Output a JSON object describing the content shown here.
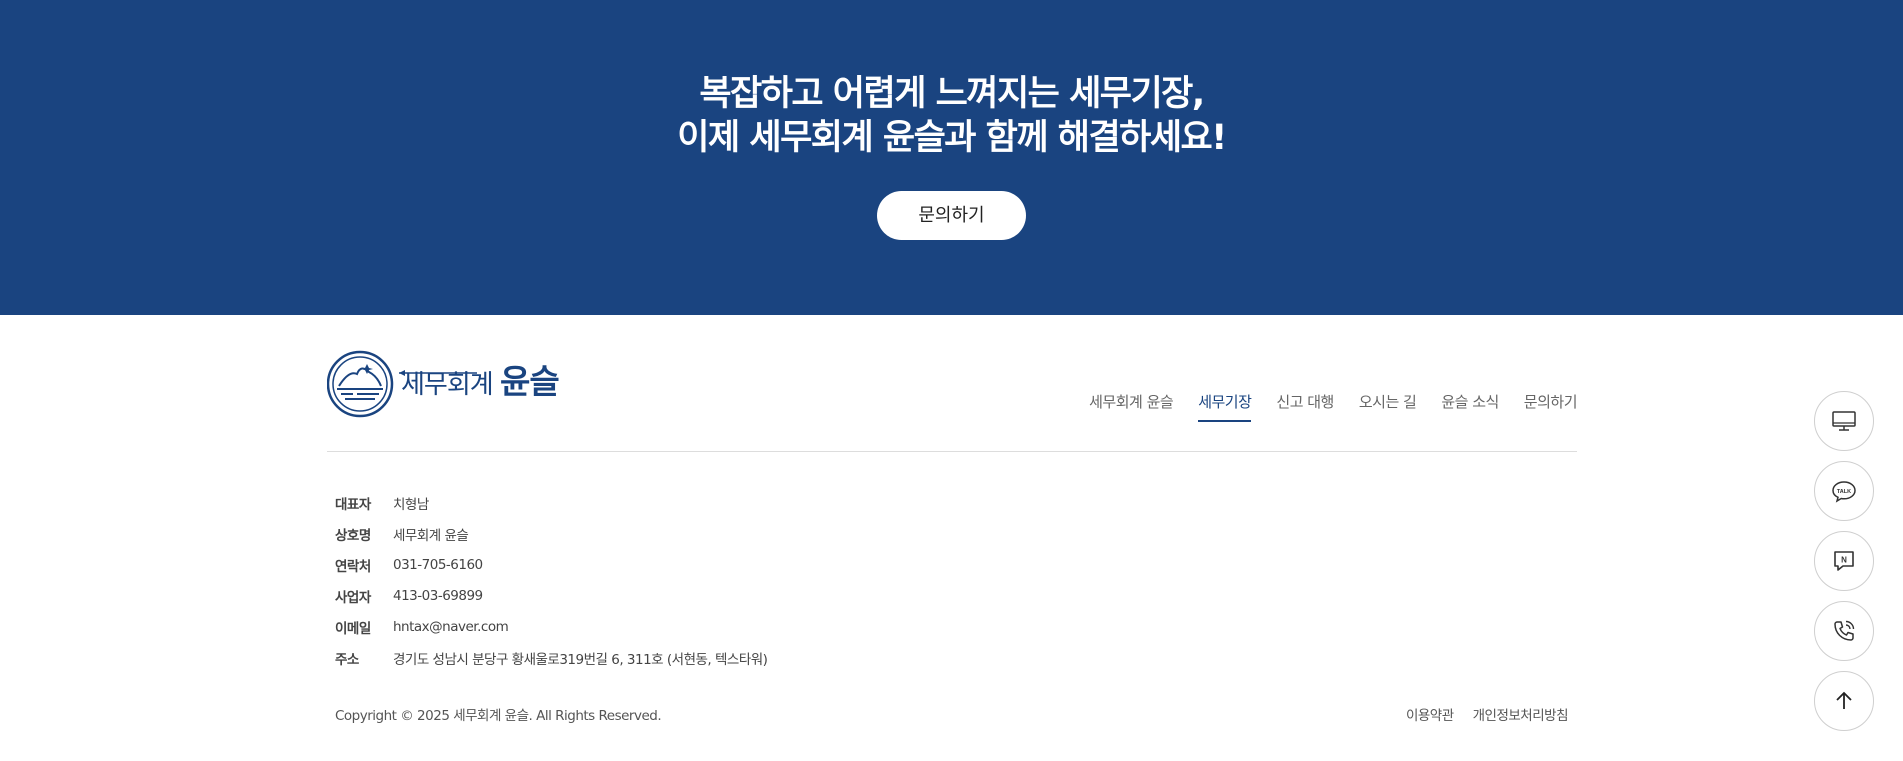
{
  "cta": {
    "title_line1": "복잡하고 어렵게 느껴지는 세무기장,",
    "title_line2": "이제 세무회계 윤슬과 함께 해결하세요!",
    "button_label": "문의하기"
  },
  "logo": {
    "text_small": "세무회계",
    "text_big": "윤슬",
    "brand_color": "#1a4480"
  },
  "nav": {
    "items": [
      {
        "label": "세무회계 윤슬"
      },
      {
        "label": "세무기장"
      },
      {
        "label": "신고 대행"
      },
      {
        "label": "오시는 길"
      },
      {
        "label": "윤슬 소식"
      },
      {
        "label": "문의하기"
      }
    ],
    "active": "세무기장"
  },
  "info": [
    {
      "label": "대표자",
      "value": "치형남"
    },
    {
      "label": "상호명",
      "value": "세무회계 윤슬"
    },
    {
      "label": "연락처",
      "value": "031-705-6160"
    },
    {
      "label": "사업자",
      "value": "413-03-69899"
    },
    {
      "label": "이메일",
      "value": "hntax@naver.com"
    },
    {
      "label": "주소",
      "value": "경기도 성남시 분당구 황새울로319번길 6, 311호 (서현동, 텍스타워)"
    }
  ],
  "footer": {
    "copyright": "Copyright © 2025 세무회계 윤슬. All Rights Reserved.",
    "terms": "이용약관",
    "privacy": "개인정보처리방침"
  },
  "quick_menu": [
    {
      "icon": "monitor-icon"
    },
    {
      "icon": "kakao-talk-icon",
      "text": "TALK"
    },
    {
      "icon": "naver-talk-icon",
      "text": "N"
    },
    {
      "icon": "phone-icon"
    },
    {
      "icon": "arrow-up-icon"
    }
  ],
  "colors": {
    "cta_background": "#1a4480",
    "accent": "#1a4480"
  }
}
